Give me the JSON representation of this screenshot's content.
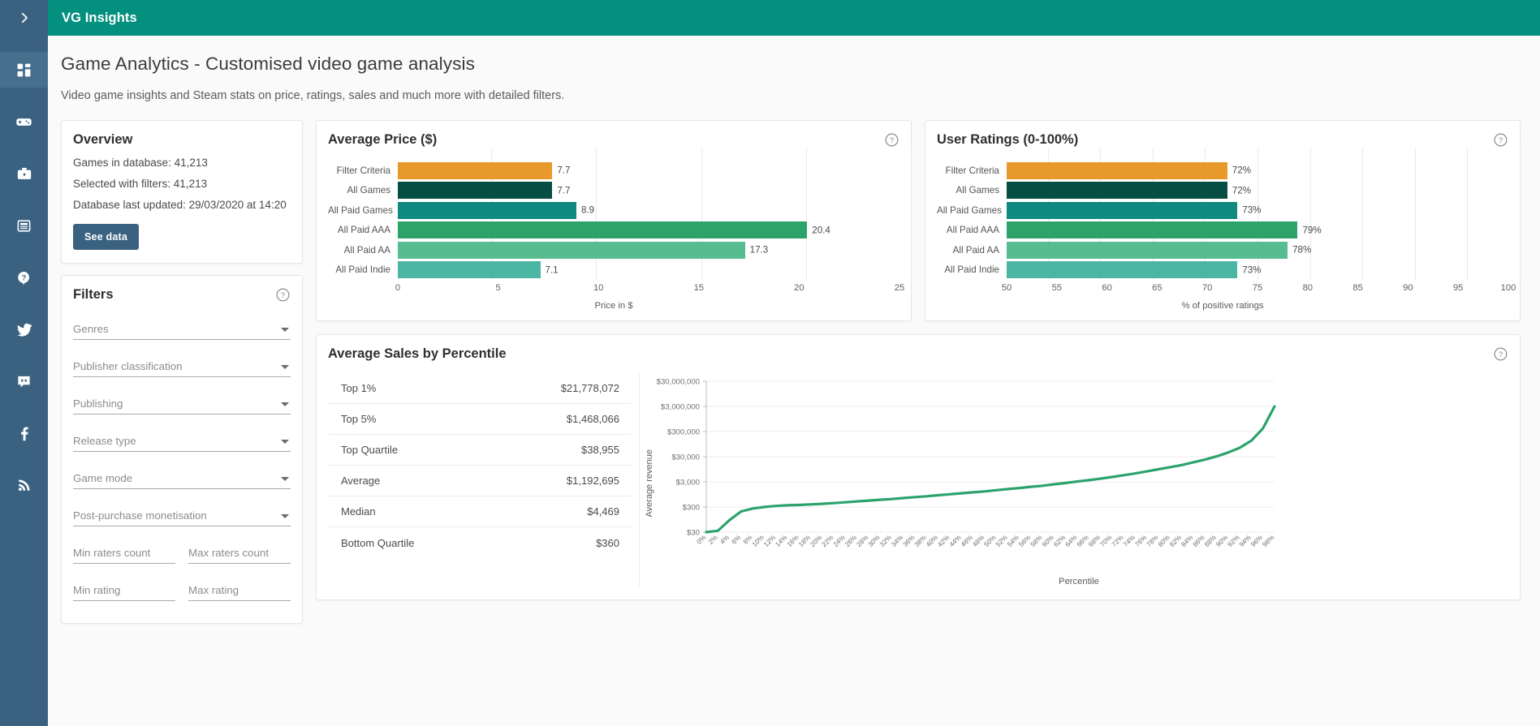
{
  "app": {
    "brand": "VG Insights",
    "accent_header": "#03907f",
    "sidebar_bg": "#3a6280",
    "button_bg": "#3a6280"
  },
  "sidebar": {
    "toggle_label": "expand-sidebar",
    "items": [
      {
        "name": "dashboard",
        "icon": "dashboard-grid-icon",
        "active": true
      },
      {
        "name": "games",
        "icon": "gamepad-icon",
        "active": false
      },
      {
        "name": "publishers",
        "icon": "briefcase-icon",
        "active": false
      },
      {
        "name": "articles",
        "icon": "article-icon",
        "active": false
      },
      {
        "name": "help",
        "icon": "help-question-icon",
        "active": false
      },
      {
        "name": "twitter",
        "icon": "twitter-icon",
        "active": false
      },
      {
        "name": "discord",
        "icon": "discord-icon",
        "active": false
      },
      {
        "name": "facebook",
        "icon": "facebook-icon",
        "active": false
      },
      {
        "name": "rss",
        "icon": "rss-icon",
        "active": false
      }
    ]
  },
  "page": {
    "title": "Game Analytics - Customised video game analysis",
    "subtitle": "Video game insights and Steam stats on price, ratings, sales and much more with detailed filters."
  },
  "overview": {
    "title": "Overview",
    "lines": [
      "Games in database: 41,213",
      "Selected with filters: 41,213",
      "Database last updated: 29/03/2020 at 14:20"
    ],
    "button_label": "See data"
  },
  "filters": {
    "title": "Filters",
    "help_icon": "help-circle-icon",
    "selects": [
      {
        "label": "Genres",
        "value": ""
      },
      {
        "label": "Publisher classification",
        "value": ""
      },
      {
        "label": "Publishing",
        "value": ""
      },
      {
        "label": "Release type",
        "value": ""
      },
      {
        "label": "Game mode",
        "value": ""
      },
      {
        "label": "Post-purchase monetisation",
        "value": ""
      }
    ],
    "pairs": [
      {
        "left": "Min raters count",
        "right": "Max raters count"
      },
      {
        "left": "Min rating",
        "right": "Max rating"
      }
    ]
  },
  "chart_data": [
    {
      "type": "bar",
      "orientation": "horizontal",
      "title": "Average Price ($)",
      "xlabel": "Price in $",
      "ylabel": "",
      "xlim": [
        0,
        25
      ],
      "xticks": [
        0,
        5,
        10,
        15,
        20,
        25
      ],
      "grid": true,
      "categories": [
        "Filter Criteria",
        "All Games",
        "All Paid Games",
        "All Paid AAA",
        "All Paid AA",
        "All Paid Indie"
      ],
      "values": [
        7.7,
        7.7,
        8.9,
        20.4,
        17.3,
        7.1
      ],
      "value_labels": [
        "7.7",
        "7.7",
        "8.9",
        "20.4",
        "17.3",
        "7.1"
      ],
      "colors": [
        "#e8992b",
        "#064d43",
        "#0f8a80",
        "#2da36c",
        "#57bc90",
        "#4cb6a4"
      ]
    },
    {
      "type": "bar",
      "orientation": "horizontal",
      "title": "User Ratings (0-100%)",
      "xlabel": "% of positive ratings",
      "ylabel": "",
      "xlim": [
        50,
        100
      ],
      "xticks": [
        50,
        55,
        60,
        65,
        70,
        75,
        80,
        85,
        90,
        95,
        100
      ],
      "grid": true,
      "categories": [
        "Filter Criteria",
        "All Games",
        "All Paid Games",
        "All Paid AAA",
        "All Paid AA",
        "All Paid Indie"
      ],
      "values": [
        72,
        72,
        73,
        79,
        78,
        73
      ],
      "value_labels": [
        "72%",
        "72%",
        "73%",
        "79%",
        "78%",
        "73%"
      ],
      "colors": [
        "#e8992b",
        "#064d43",
        "#0f8a80",
        "#2da36c",
        "#57bc90",
        "#4cb6a4"
      ]
    },
    {
      "type": "line",
      "title": "Average Sales by Percentile",
      "xlabel": "Percentile",
      "ylabel": "Average revenue",
      "yscale": "log",
      "yticks": [
        30,
        300,
        3000,
        30000,
        300000,
        3000000,
        30000000
      ],
      "ytick_labels": [
        "$30",
        "$300",
        "$3,000",
        "$30,000",
        "$300,000",
        "$3,000,000",
        "$30,000,000"
      ],
      "line_color": "#2da36c",
      "grid": true,
      "x": [
        "0%",
        "2%",
        "4%",
        "6%",
        "8%",
        "10%",
        "12%",
        "14%",
        "16%",
        "18%",
        "20%",
        "22%",
        "24%",
        "26%",
        "28%",
        "30%",
        "32%",
        "34%",
        "36%",
        "38%",
        "40%",
        "42%",
        "44%",
        "46%",
        "48%",
        "50%",
        "52%",
        "54%",
        "56%",
        "58%",
        "60%",
        "62%",
        "64%",
        "66%",
        "68%",
        "70%",
        "72%",
        "74%",
        "76%",
        "78%",
        "80%",
        "82%",
        "84%",
        "86%",
        "88%",
        "90%",
        "92%",
        "94%",
        "96%",
        "98%"
      ],
      "values": [
        22,
        34,
        90,
        200,
        260,
        300,
        330,
        350,
        360,
        380,
        400,
        430,
        460,
        500,
        540,
        580,
        620,
        680,
        740,
        800,
        880,
        960,
        1050,
        1150,
        1250,
        1400,
        1550,
        1700,
        1900,
        2100,
        2400,
        2700,
        3100,
        3500,
        4000,
        4700,
        5500,
        6500,
        7800,
        9500,
        11500,
        14000,
        18000,
        23000,
        31000,
        44000,
        68000,
        130000,
        400000,
        3000000
      ]
    }
  ],
  "price_card": {
    "title": "Average Price ($)",
    "help_icon": "help-circle-icon"
  },
  "ratings_card": {
    "title": "User Ratings (0-100%)",
    "help_icon": "help-circle-icon"
  },
  "sales_card": {
    "title": "Average Sales by Percentile",
    "help_icon": "help-circle-icon",
    "rows": [
      {
        "label": "Top 1%",
        "value": "$21,778,072"
      },
      {
        "label": "Top 5%",
        "value": "$1,468,066"
      },
      {
        "label": "Top Quartile",
        "value": "$38,955"
      },
      {
        "label": "Average",
        "value": "$1,192,695"
      },
      {
        "label": "Median",
        "value": "$4,469"
      },
      {
        "label": "Bottom Quartile",
        "value": "$360"
      }
    ]
  }
}
